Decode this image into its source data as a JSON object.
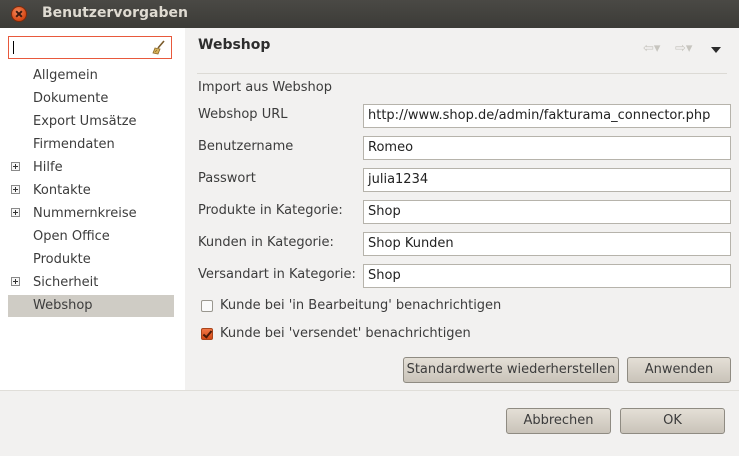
{
  "window": {
    "title": "Benutzervorgaben"
  },
  "sidebar": {
    "filter": {
      "value": ""
    },
    "items": [
      {
        "label": "Allgemein",
        "expandable": false,
        "selected": false
      },
      {
        "label": "Dokumente",
        "expandable": false,
        "selected": false
      },
      {
        "label": "Export Umsätze",
        "expandable": false,
        "selected": false
      },
      {
        "label": "Firmendaten",
        "expandable": false,
        "selected": false
      },
      {
        "label": "Hilfe",
        "expandable": true,
        "selected": false
      },
      {
        "label": "Kontakte",
        "expandable": true,
        "selected": false
      },
      {
        "label": "Nummernkreise",
        "expandable": true,
        "selected": false
      },
      {
        "label": "Open Office",
        "expandable": false,
        "selected": false
      },
      {
        "label": "Produkte",
        "expandable": false,
        "selected": false
      },
      {
        "label": "Sicherheit",
        "expandable": true,
        "selected": false
      },
      {
        "label": "Webshop",
        "expandable": false,
        "selected": true
      }
    ]
  },
  "page": {
    "title": "Webshop",
    "group_title": "Import aus Webshop",
    "fields": [
      {
        "label": "Webshop URL",
        "value": "http://www.shop.de/admin/fakturama_connector.php"
      },
      {
        "label": "Benutzername",
        "value": "Romeo"
      },
      {
        "label": "Passwort",
        "value": "julia1234"
      },
      {
        "label": "Produkte in Kategorie:",
        "value": "Shop"
      },
      {
        "label": "Kunden in Kategorie:",
        "value": "Shop Kunden"
      },
      {
        "label": "Versandart in Kategorie:",
        "value": "Shop"
      }
    ],
    "checkboxes": [
      {
        "label": "Kunde bei 'in Bearbeitung' benachrichtigen",
        "checked": false
      },
      {
        "label": "Kunde bei 'versendet' benachrichtigen",
        "checked": true
      }
    ],
    "restore_defaults_label": "Standardwerte wiederherstellen",
    "apply_label": "Anwenden"
  },
  "dialog": {
    "cancel_label": "Abbrechen",
    "ok_label": "OK"
  },
  "icons": {
    "close": "close-icon",
    "filter_clear": "broom-icon",
    "back": "arrow-left-icon",
    "forward": "arrow-right-icon",
    "menu": "triangle-down-icon",
    "expand": "plus-box-icon"
  },
  "colors": {
    "accent": "#e8593d",
    "selection": "#cfccc5",
    "titlebar": "#3c3b37"
  }
}
